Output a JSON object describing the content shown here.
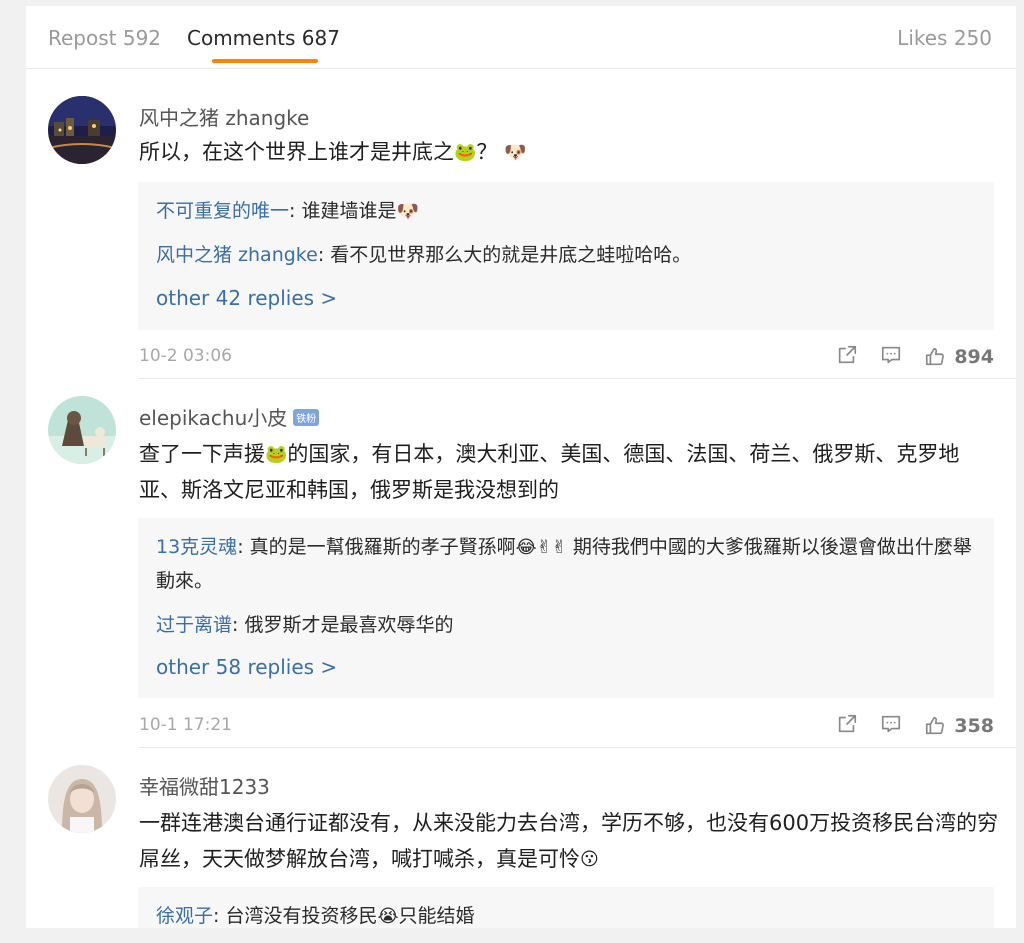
{
  "tabs": {
    "repost": "Repost 592",
    "comments": "Comments 687",
    "likes": "Likes 250"
  },
  "comments": [
    {
      "user": "风中之猪 zhangke",
      "text_a": "所以，在这个世界上谁才是井底之",
      "text_b": "？",
      "emoji_frog": "🐸",
      "emoji_end": "🐶",
      "replies": [
        {
          "user": "不可重复的唯一",
          "text": ": 谁建墙谁是",
          "emoji": "🐶"
        },
        {
          "user": "风中之猪 zhangke",
          "text": ": 看不见世界那么大的就是井底之蛙啦哈哈。"
        }
      ],
      "more": "other 42 replies >",
      "date": "10-2 03:06",
      "likes": "894"
    },
    {
      "user": "elepikachu小皮",
      "badge": "铁粉",
      "text_a": "查了一下声援",
      "emoji_frog": "🐸",
      "text_b": "的国家，有日本，澳大利亚、美国、德国、法国、荷兰、俄罗斯、克罗地亚、斯洛文尼亚和韩国，俄罗斯是我没想到的",
      "replies": [
        {
          "user": "13克灵魂",
          "text": ": 真的是一幫俄羅斯的孝子賢孫啊",
          "emoji": "😂✌✌",
          "text2": " 期待我們中國的大爹俄羅斯以後還會做出什麼舉動來。"
        },
        {
          "user": "过于离谱",
          "text": ": 俄罗斯才是最喜欢辱华的"
        }
      ],
      "more": "other 58 replies >",
      "date": "10-1 17:21",
      "likes": "358"
    },
    {
      "user": "幸福微甜1233",
      "text_a": "一群连港澳台通行证都没有，从来没能力去台湾，学历不够，也没有600万投资移民台湾的穷屌丝，天天做梦解放台湾，喊打喊杀，真是可怜",
      "emoji_end": "😗",
      "replies": [
        {
          "user": "徐观子",
          "text": ": 台湾没有投资移民",
          "emoji": "😭",
          "text2": "只能结婚"
        }
      ]
    }
  ]
}
